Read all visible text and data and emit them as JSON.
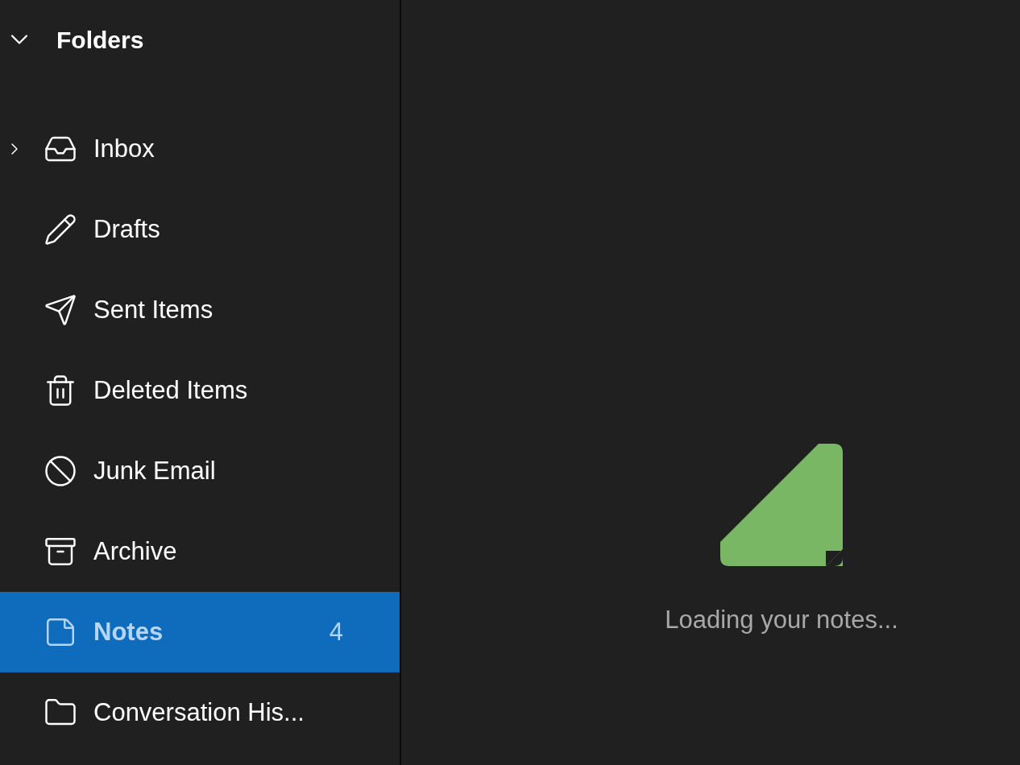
{
  "folders_header": {
    "title": "Folders",
    "expanded": true
  },
  "folders": [
    {
      "kind": "inbox",
      "label": "Inbox",
      "selected": false,
      "expandable": true,
      "expanded": false
    },
    {
      "kind": "drafts",
      "label": "Drafts",
      "selected": false,
      "expandable": false
    },
    {
      "kind": "sent",
      "label": "Sent Items",
      "selected": false,
      "expandable": false
    },
    {
      "kind": "deleted",
      "label": "Deleted Items",
      "selected": false,
      "expandable": false
    },
    {
      "kind": "junk",
      "label": "Junk Email",
      "selected": false,
      "expandable": false
    },
    {
      "kind": "archive",
      "label": "Archive",
      "selected": false,
      "expandable": false
    },
    {
      "kind": "notes",
      "label": "Notes",
      "selected": true,
      "expandable": false,
      "count": "4"
    },
    {
      "kind": "folder",
      "label": "Conversation His...",
      "selected": false,
      "expandable": false
    }
  ],
  "main": {
    "message": "Loading your notes..."
  }
}
